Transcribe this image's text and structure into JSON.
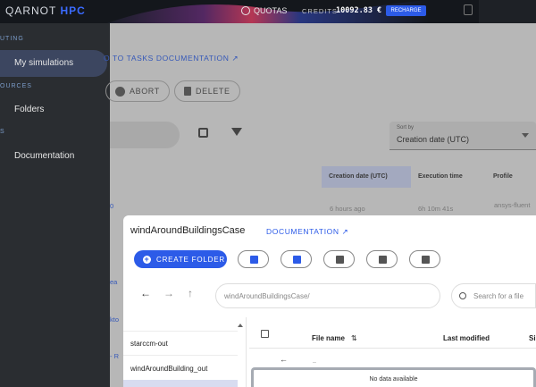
{
  "topbar": {
    "brand_prefix": "QARNOT",
    "brand_suffix": "HPC",
    "quotas": "QUOTAS",
    "credits_label": "CREDITS",
    "credits_value": "10092.83 €",
    "recharge": "RECHARGE"
  },
  "sidebar": {
    "sections": [
      "UTING",
      "OURCES",
      "S"
    ],
    "items": [
      {
        "label": "My simulations",
        "active": true
      },
      {
        "label": "Folders",
        "active": false
      },
      {
        "label": "Documentation",
        "active": false
      }
    ]
  },
  "main": {
    "doc_link": "O TO TASKS DOCUMENTATION ↗",
    "abort": "ABORT",
    "delete": "DELETE",
    "sort_label": "Sort by",
    "sort_value": "Creation date (UTC)",
    "columns": [
      "Creation date (UTC)",
      "Execution time",
      "Profile"
    ],
    "row_time": "6 hours ago",
    "row_exec": "6h 10m 41s",
    "row_profile": "ansys-fluent"
  },
  "dialog": {
    "title": "windAroundBuildingsCase",
    "doc": "DOCUMENTATION ↗",
    "create_folder": "CREATE FOLDER",
    "path": "windAroundBuildingsCase/",
    "search_placeholder": "Search for a file",
    "folders": [
      "starccm-out",
      "windAroundBuilding_out"
    ],
    "col_file": "File name",
    "col_modified": "Last modified",
    "col_size": "Si",
    "parent": "..",
    "no_data": "No data available"
  }
}
